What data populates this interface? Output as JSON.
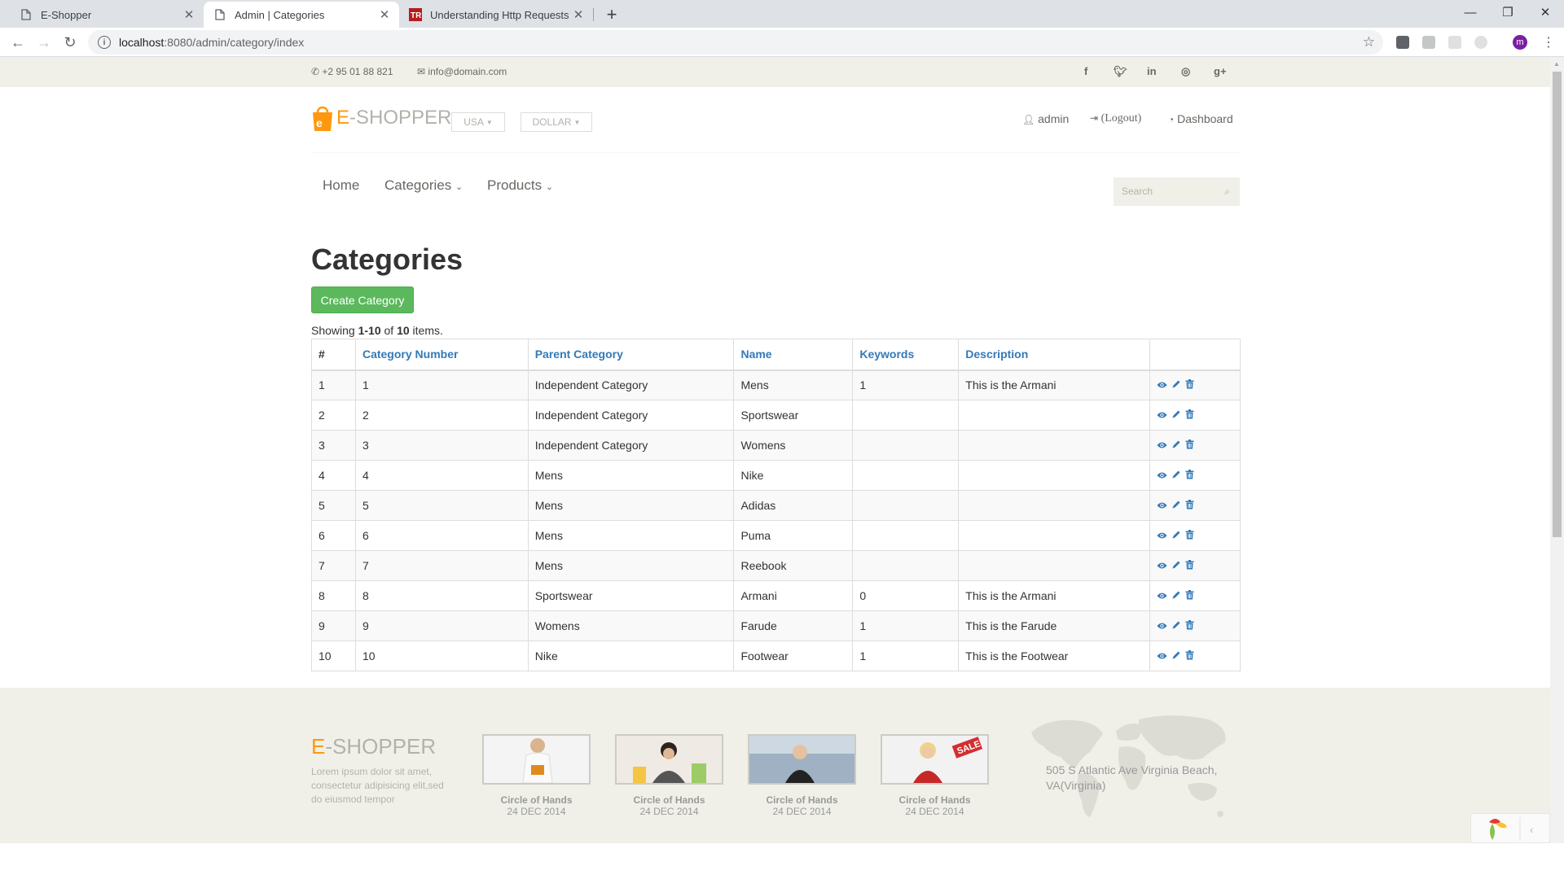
{
  "browser": {
    "tabs": [
      {
        "title": "E-Shopper",
        "active": false
      },
      {
        "title": "Admin | Categories",
        "active": true
      },
      {
        "title": "Understanding Http Requests in",
        "active": false
      }
    ],
    "url_host": "localhost",
    "url_path": ":8080/admin/category/index",
    "profile_initial": "m"
  },
  "topbar": {
    "phone": "+2 95 01 88 821",
    "email": "info@domain.com",
    "social_icons": [
      "facebook-icon",
      "twitter-icon",
      "linkedin-icon",
      "dribbble-icon",
      "google-plus-icon"
    ]
  },
  "header": {
    "brand_e": "E",
    "brand_rest": "-SHOPPER",
    "country": "USA",
    "currency": "DOLLAR",
    "user": "admin",
    "logout": "(Logout)",
    "dashboard": "Dashboard"
  },
  "nav": {
    "home": "Home",
    "categories": "Categories",
    "products": "Products",
    "search_placeholder": "Search"
  },
  "main": {
    "title": "Categories",
    "create_button": "Create Category",
    "summary_prefix": "Showing ",
    "summary_range": "1-10",
    "summary_mid": " of ",
    "summary_total": "10",
    "summary_suffix": " items."
  },
  "table": {
    "headers": [
      "#",
      "Category Number",
      "Parent Category",
      "Name",
      "Keywords",
      "Description"
    ],
    "rows": [
      [
        "1",
        "1",
        "Independent Category",
        "Mens",
        "1",
        "This is the Armani"
      ],
      [
        "2",
        "2",
        "Independent Category",
        "Sportswear",
        "",
        ""
      ],
      [
        "3",
        "3",
        "Independent Category",
        "Womens",
        "",
        ""
      ],
      [
        "4",
        "4",
        "Mens",
        "Nike",
        "",
        ""
      ],
      [
        "5",
        "5",
        "Mens",
        "Adidas",
        "",
        ""
      ],
      [
        "6",
        "6",
        "Mens",
        "Puma",
        "",
        ""
      ],
      [
        "7",
        "7",
        "Mens",
        "Reebook",
        "",
        ""
      ],
      [
        "8",
        "8",
        "Sportswear",
        "Armani",
        "0",
        "This is the Armani"
      ],
      [
        "9",
        "9",
        "Womens",
        "Farude",
        "1",
        "This is the Farude"
      ],
      [
        "10",
        "10",
        "Nike",
        "Footwear",
        "1",
        "This is the Footwear"
      ]
    ]
  },
  "footer": {
    "brand_e": "E",
    "brand_rest": "-SHOPPER",
    "description": "Lorem ipsum dolor sit amet, consectetur adipisicing elit,sed do eiusmod tempor",
    "videos": [
      {
        "caption": "Circle of Hands",
        "date": "24 DEC 2014"
      },
      {
        "caption": "Circle of Hands",
        "date": "24 DEC 2014"
      },
      {
        "caption": "Circle of Hands",
        "date": "24 DEC 2014"
      },
      {
        "caption": "Circle of Hands",
        "date": "24 DEC 2014"
      }
    ],
    "address": "505 S Atlantic Ave Virginia Beach, VA(Virginia)",
    "sale_badge": "SALE"
  },
  "colors": {
    "brand_orange": "#fe980f",
    "link_blue": "#337ab7",
    "success_green": "#5cb85c",
    "strip_bg": "#f0f0e9"
  }
}
